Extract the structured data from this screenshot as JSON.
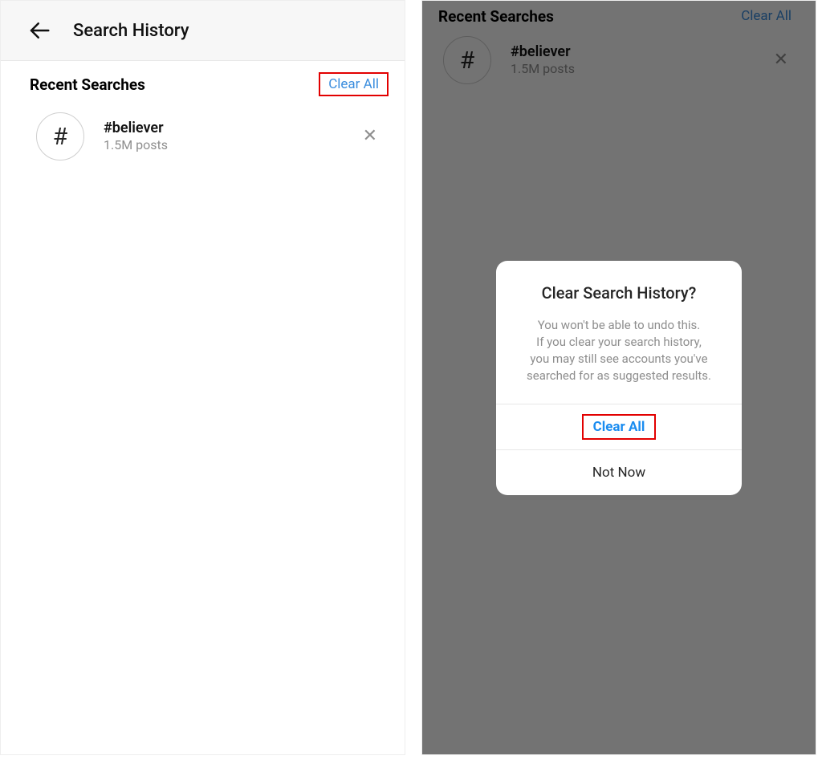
{
  "colors": {
    "link_blue": "#3a8dde",
    "highlight_red": "#e20000",
    "text_muted": "#8e8e8e"
  },
  "left": {
    "header_title": "Search History",
    "section_title": "Recent Searches",
    "clear_label": "Clear All",
    "item": {
      "hash_symbol": "#",
      "name": "#believer",
      "sub": "1.5M posts",
      "close_glyph": "✕"
    }
  },
  "right": {
    "section_title": "Recent Searches",
    "clear_label": "Clear All",
    "item": {
      "hash_symbol": "#",
      "name": "#believer",
      "sub": "1.5M posts",
      "close_glyph": "✕"
    },
    "dialog": {
      "title": "Clear Search History?",
      "message": "You won't be able to undo this.\nIf you clear your search history,\nyou may still see accounts you've\nsearched for as suggested results.",
      "primary_label": "Clear All",
      "secondary_label": "Not Now"
    }
  }
}
